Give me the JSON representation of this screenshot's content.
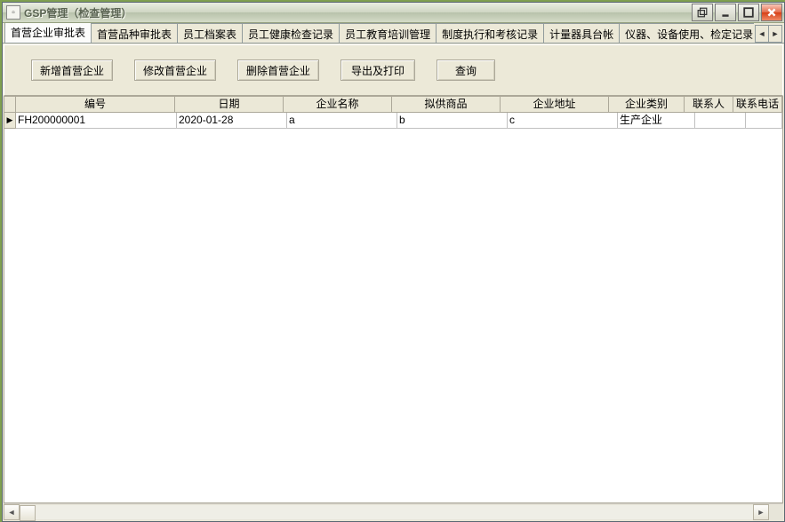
{
  "window": {
    "title": "GSP管理（检查管理）"
  },
  "tabs": [
    "首营企业审批表",
    "首营品种审批表",
    "员工档案表",
    "员工健康检查记录",
    "员工教育培训管理",
    "制度执行和考核记录",
    "计量器具台帐",
    "仪器、设备使用、检定记录"
  ],
  "toolbar": {
    "new_label": "新增首营企业",
    "edit_label": "修改首营企业",
    "delete_label": "删除首营企业",
    "export_label": "导出及打印",
    "search_label": "查询"
  },
  "columns": {
    "c1": "编号",
    "c2": "日期",
    "c3": "企业名称",
    "c4": "拟供商品",
    "c5": "企业地址",
    "c6": "企业类别",
    "c7": "联系人",
    "c8": "联系电话"
  },
  "rows": [
    {
      "c1": "FH200000001",
      "c2": "2020-01-28",
      "c3": "a",
      "c4": "b",
      "c5": "c",
      "c6": "生产企业",
      "c7": "",
      "c8": ""
    }
  ],
  "icons": {
    "row_indicator": "▶"
  }
}
